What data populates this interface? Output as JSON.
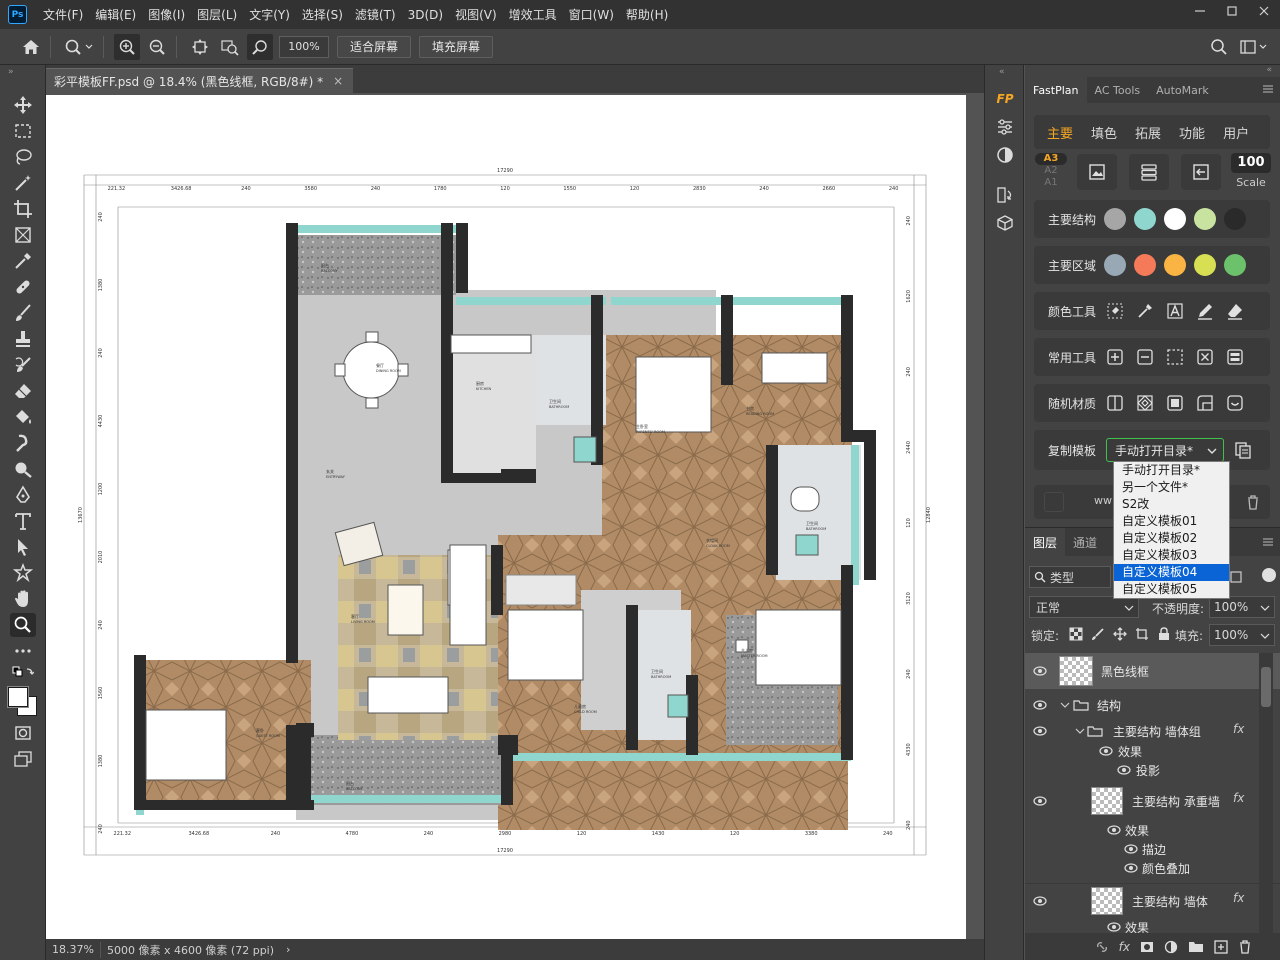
{
  "app": {
    "logo": "Ps",
    "menu": [
      "文件(F)",
      "编辑(E)",
      "图像(I)",
      "图层(L)",
      "文字(Y)",
      "选择(S)",
      "滤镜(T)",
      "3D(D)",
      "视图(V)",
      "增效工具",
      "窗口(W)",
      "帮助(H)"
    ],
    "window_controls": [
      "minimize-icon",
      "restore-icon",
      "close-icon"
    ]
  },
  "options_bar": {
    "zoom_value": "100%",
    "fit_screen": "适合屏幕",
    "fill_screen": "填充屏幕"
  },
  "document": {
    "tab_title": "彩平模板FF.psd @ 18.4% (黑色线框, RGB/8#) *",
    "close": "×"
  },
  "status": {
    "zoom": "18.37%",
    "size": "5000 像素 x 4600 像素 (72 ppi)",
    "arrow": "›"
  },
  "floorplan": {
    "dims_top": [
      "221.32",
      "3426.68",
      "240",
      "3580",
      "240",
      "1780",
      "120",
      "1550",
      "120",
      "2830",
      "240",
      "2660",
      "240"
    ],
    "total_top": "17290",
    "dims_bottom": [
      "221.32",
      "3426.68",
      "240",
      "4780",
      "240",
      "2980",
      "120",
      "1430",
      "120",
      "3380",
      "240"
    ],
    "total_bottom": "17290",
    "dims_left": [
      "240",
      "1380",
      "240",
      "4430",
      "1200",
      "2010",
      "240",
      "1560",
      "1380",
      "240"
    ],
    "total_left": "13670",
    "dims_right": [
      "240",
      "1620",
      "240",
      "2440",
      "120",
      "3120",
      "240",
      "4330",
      "240"
    ],
    "total_right": "12840",
    "rooms": [
      {
        "cn": "阳台",
        "en": "BALCONY"
      },
      {
        "cn": "餐厅",
        "en": "DINING ROOM"
      },
      {
        "cn": "厨房",
        "en": "KITCHEN"
      },
      {
        "cn": "卫生间",
        "en": "BATHROOM"
      },
      {
        "cn": "主卧室",
        "en": "PARENTS' ROOM"
      },
      {
        "cn": "书房",
        "en": "READING ROOM"
      },
      {
        "cn": "玄关",
        "en": "ENTRYWAY"
      },
      {
        "cn": "衣帽间",
        "en": "CLOAK ROOM"
      },
      {
        "cn": "卫生间",
        "en": "BATHROOM"
      },
      {
        "cn": "客厅",
        "en": "LIVING ROOM"
      },
      {
        "cn": "儿童房",
        "en": "CHILD ROOM"
      },
      {
        "cn": "卫生间",
        "en": "BATHROOM"
      },
      {
        "cn": "主人房",
        "en": "MASTER ROOM"
      },
      {
        "cn": "客卧",
        "en": "GUEST ROOM"
      },
      {
        "cn": "阳台",
        "en": "BALCONY"
      }
    ]
  },
  "fastplan": {
    "tabs": [
      "FastPlan",
      "AC Tools",
      "AutoMark"
    ],
    "sub_tabs": [
      "主要",
      "填色",
      "拓展",
      "功能",
      "用户"
    ],
    "paper_sizes": [
      "A3",
      "A2",
      "A1"
    ],
    "scale_value": "100",
    "scale_label": "Scale",
    "rows": {
      "structure": "主要结构",
      "region": "主要区域",
      "color_tools": "颜色工具",
      "common_tools": "常用工具",
      "random_material": "随机材质",
      "copy_template": "复制模板"
    },
    "structure_colors": [
      "#a6a6a6",
      "#8fd6cf",
      "#ffffff",
      "#c8e3a0",
      "#2a2a2a"
    ],
    "region_colors": [
      "#98a9b5",
      "#f47a5a",
      "#f9b444",
      "#d6e052",
      "#6cc26b"
    ],
    "template_select": "手动打开目录*",
    "template_options": [
      "手动打开目录*",
      "另一个文件*",
      "S2改",
      "自定义模板01",
      "自定义模板02",
      "自定义模板03",
      "自定义模板04",
      "自定义模板05"
    ],
    "selected_template": 6,
    "www_text": "ww"
  },
  "layers": {
    "tabs": [
      "图层",
      "通道"
    ],
    "filter": "类型",
    "blend_mode": "正常",
    "opacity_label": "不透明度:",
    "opacity": "100%",
    "lock_label": "锁定:",
    "fill_label": "填充:",
    "fill": "100%",
    "items": [
      {
        "name": "黑色线框"
      },
      {
        "name": "结构"
      },
      {
        "name": "主要结构 墙体组",
        "fx": "fx"
      },
      {
        "name": "效果"
      },
      {
        "name": "投影"
      },
      {
        "name": "主要结构 承重墙",
        "fx": "fx"
      },
      {
        "name": "效果"
      },
      {
        "name": "描边"
      },
      {
        "name": "颜色叠加"
      },
      {
        "name": "主要结构 墙体",
        "fx": "fx"
      },
      {
        "name": "效果"
      }
    ]
  }
}
